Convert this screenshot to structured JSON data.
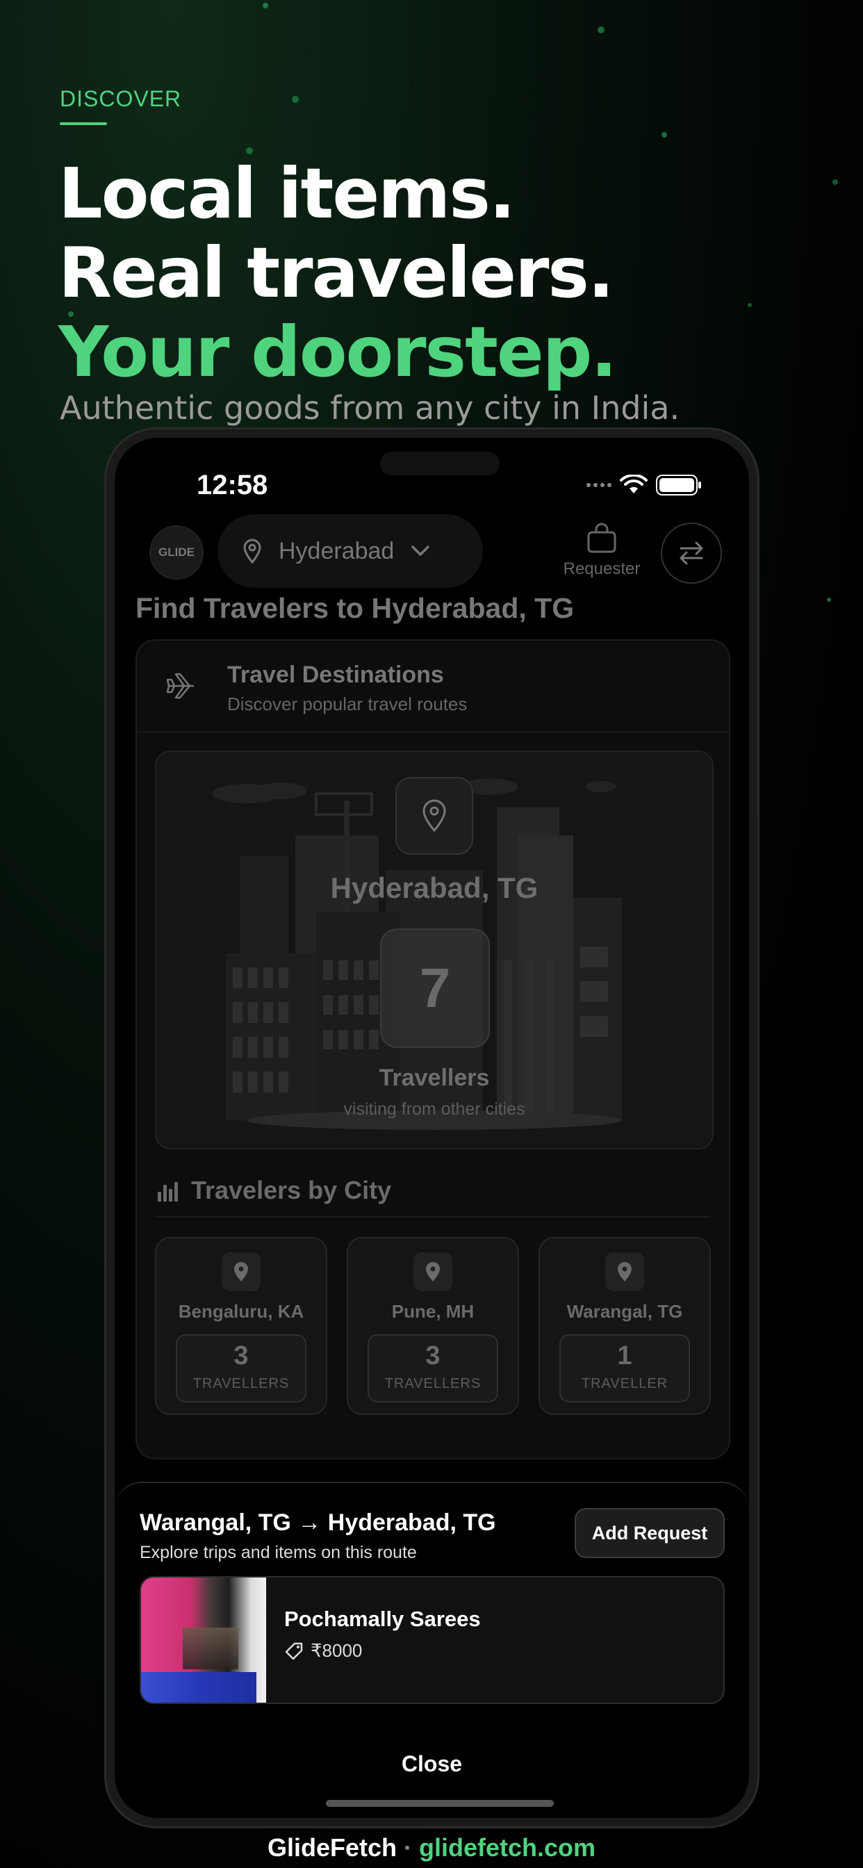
{
  "marketing": {
    "eyebrow": "DISCOVER",
    "headline_line1": "Local items.",
    "headline_line2": "Real travelers.",
    "headline_line3": "Your doorstep.",
    "subhead": "Authentic goods from any city in India.",
    "accent_color": "#4fd37f"
  },
  "status_bar": {
    "time": "12:58"
  },
  "app_header": {
    "logo_text": "GLIDE",
    "location": "Hyderabad",
    "role_label": "Requester"
  },
  "page": {
    "title": "Find Travelers to Hyderabad, TG"
  },
  "destinations_card": {
    "title": "Travel Destinations",
    "subtitle": "Discover popular travel routes",
    "hero_city": "Hyderabad, TG",
    "hero_count": "7",
    "hero_label": "Travellers",
    "hero_sub": "visiting from other cities",
    "by_city_title": "Travelers by City",
    "cities": [
      {
        "name": "Bengaluru, KA",
        "count": "3",
        "label": "TRAVELLERS"
      },
      {
        "name": "Pune, MH",
        "count": "3",
        "label": "TRAVELLERS"
      },
      {
        "name": "Warangal, TG",
        "count": "1",
        "label": "TRAVELLER"
      }
    ]
  },
  "route_sheet": {
    "title": "Warangal, TG → Hyderabad, TG",
    "subtitle": "Explore trips and items on this route",
    "add_request_label": "Add Request",
    "item_name": "Pochamally Sarees",
    "item_price": "₹8000",
    "close_label": "Close"
  },
  "footer": {
    "brand": "GlideFetch",
    "separator": "·",
    "url": "glidefetch.com"
  }
}
